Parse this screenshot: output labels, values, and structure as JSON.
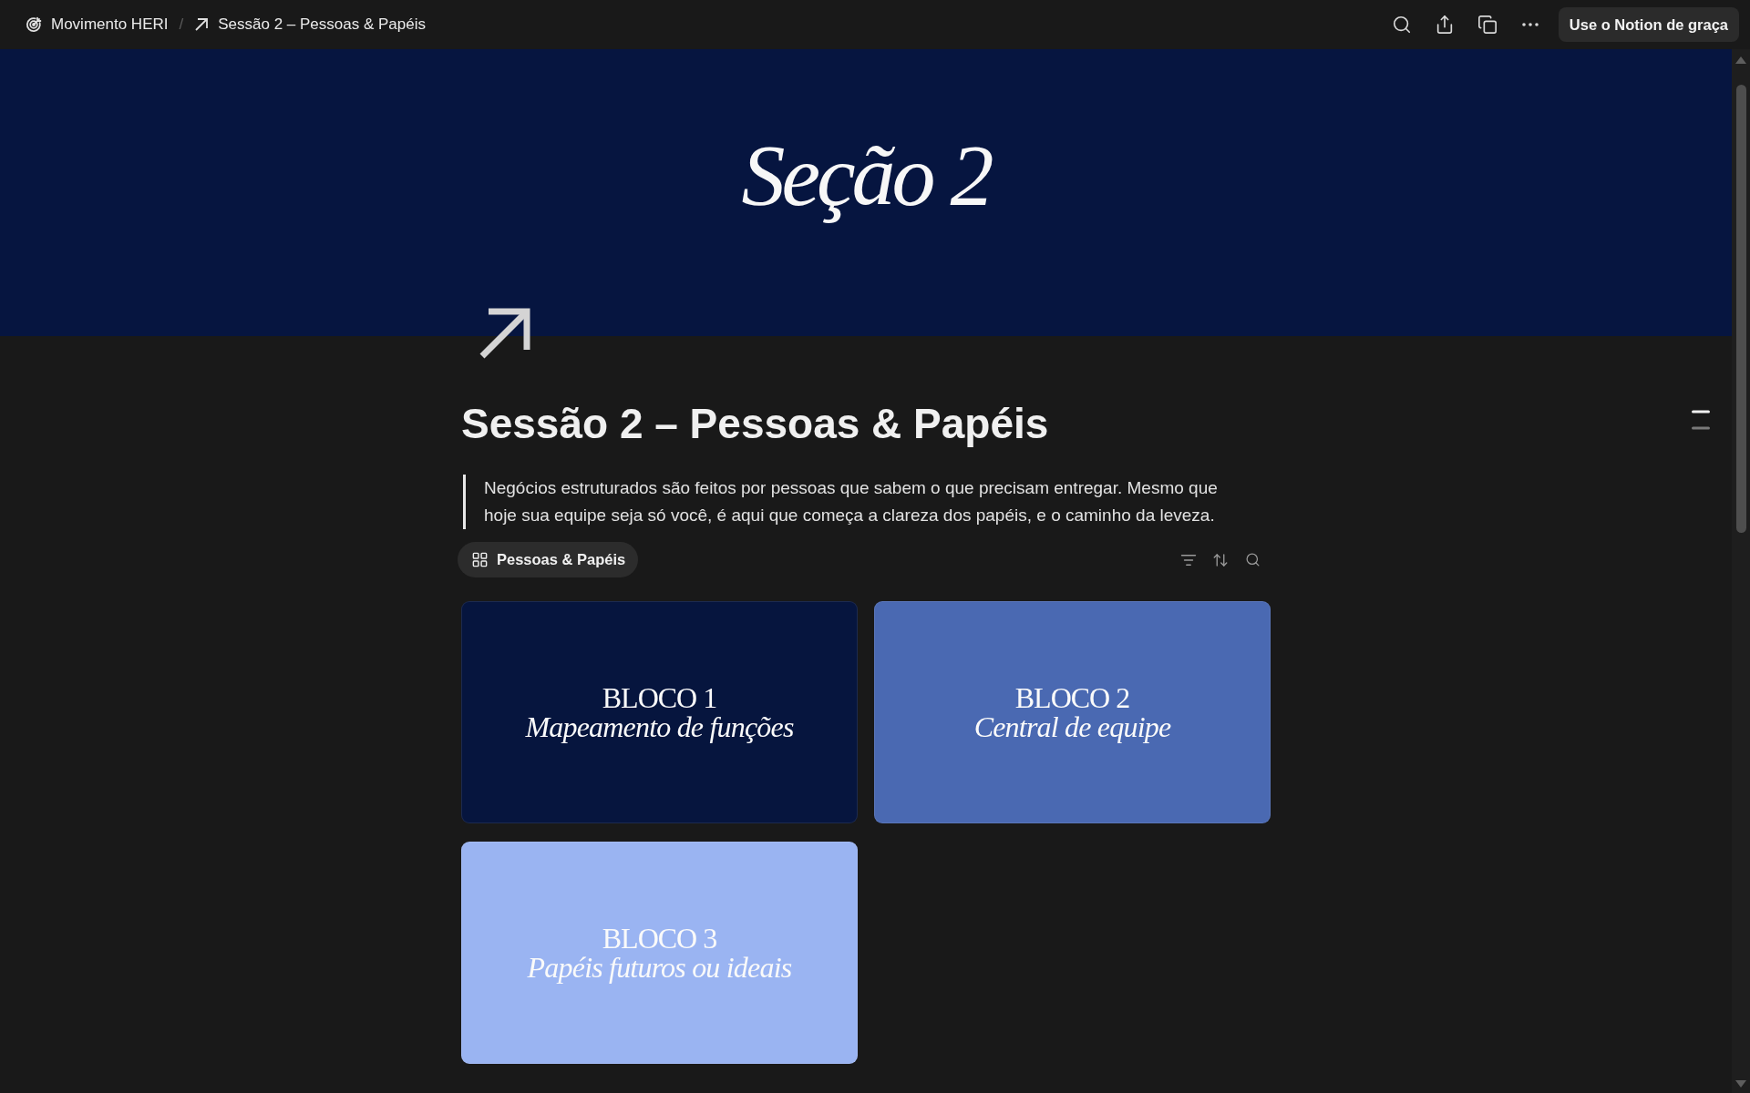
{
  "top_bar": {
    "breadcrumbs": [
      {
        "label": "Movimento HERI"
      },
      {
        "label": "Sessão 2 – Pessoas & Papéis"
      }
    ],
    "separator": "/",
    "button": "Use o Notion de graça"
  },
  "cover": {
    "title": "Seção 2"
  },
  "page": {
    "title": "Sessão 2 – Pessoas & Papéis",
    "quote": "Negócios estruturados são feitos por pessoas que sabem o que precisam entregar. Mesmo que hoje sua equipe seja só você, é aqui que começa a clareza dos papéis, e o caminho da leveza.",
    "views": [
      {
        "label": "Pessoas & Papéis",
        "selected": true
      }
    ]
  },
  "gallery": {
    "cards": [
      {
        "title": "BLOCO 1",
        "subtitle": "Mapeamento de funções",
        "color": "#06153e"
      },
      {
        "title": "BLOCO 2",
        "subtitle": "Central de equipe",
        "color": "#4a69b2"
      },
      {
        "title": "BLOCO 3",
        "subtitle": "Papéis futuros ou ideais",
        "color": "#9ab4f2"
      }
    ]
  }
}
